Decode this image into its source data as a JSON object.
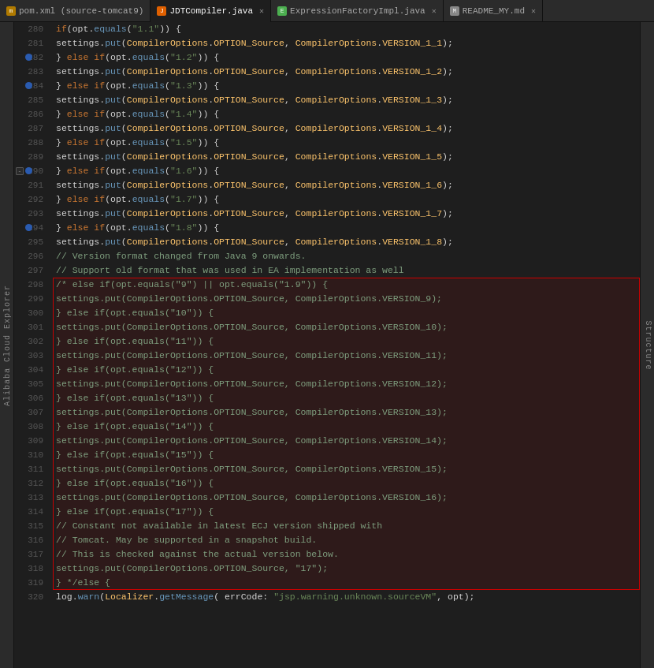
{
  "tabs": [
    {
      "id": "pom",
      "label": "pom.xml (source-tomcat9)",
      "icon": "maven",
      "active": false,
      "closable": false
    },
    {
      "id": "jdt",
      "label": "JDTCompiler.java",
      "icon": "java-j",
      "active": true,
      "closable": true
    },
    {
      "id": "expr",
      "label": "ExpressionFactoryImpl.java",
      "icon": "java-e",
      "active": false,
      "closable": true
    },
    {
      "id": "readme",
      "label": "README_MY.md",
      "icon": "md",
      "active": false,
      "closable": true
    }
  ],
  "sidebar_left": "Alibaba Cloud Explorer",
  "sidebar_right": "Structure",
  "lines": [
    {
      "num": 280,
      "indent": 2,
      "content": "if(opt.equals(\"1.1\")) {",
      "type": "code",
      "has_gutter": false
    },
    {
      "num": 281,
      "indent": 3,
      "content": "settings.put(CompilerOptions.OPTION_Source, CompilerOptions.VERSION_1_1);",
      "type": "code"
    },
    {
      "num": 282,
      "indent": 2,
      "content": "} else if(opt.equals(\"1.2\")) {",
      "type": "code"
    },
    {
      "num": 283,
      "indent": 3,
      "content": "settings.put(CompilerOptions.OPTION_Source, CompilerOptions.VERSION_1_2);",
      "type": "code"
    },
    {
      "num": 284,
      "indent": 2,
      "content": "} else if(opt.equals(\"1.3\")) {",
      "type": "code"
    },
    {
      "num": 285,
      "indent": 3,
      "content": "settings.put(CompilerOptions.OPTION_Source, CompilerOptions.VERSION_1_3);",
      "type": "code"
    },
    {
      "num": 286,
      "indent": 2,
      "content": "} else if(opt.equals(\"1.4\")) {",
      "type": "code"
    },
    {
      "num": 287,
      "indent": 3,
      "content": "settings.put(CompilerOptions.OPTION_Source, CompilerOptions.VERSION_1_4);",
      "type": "code"
    },
    {
      "num": 288,
      "indent": 2,
      "content": "} else if(opt.equals(\"1.5\")) {",
      "type": "code"
    },
    {
      "num": 289,
      "indent": 3,
      "content": "settings.put(CompilerOptions.OPTION_Source, CompilerOptions.VERSION_1_5);",
      "type": "code"
    },
    {
      "num": 290,
      "indent": 2,
      "content": "} else if(opt.equals(\"1.6\")) {",
      "type": "code",
      "has_gutter": true
    },
    {
      "num": 291,
      "indent": 3,
      "content": "settings.put(CompilerOptions.OPTION_Source, CompilerOptions.VERSION_1_6);",
      "type": "code"
    },
    {
      "num": 292,
      "indent": 2,
      "content": "} else if(opt.equals(\"1.7\")) {",
      "type": "code"
    },
    {
      "num": 293,
      "indent": 3,
      "content": "settings.put(CompilerOptions.OPTION_Source, CompilerOptions.VERSION_1_7);",
      "type": "code"
    },
    {
      "num": 294,
      "indent": 2,
      "content": "} else if(opt.equals(\"1.8\")) {",
      "type": "code"
    },
    {
      "num": 295,
      "indent": 3,
      "content": "settings.put(CompilerOptions.OPTION_Source, CompilerOptions.VERSION_1_8);",
      "type": "code"
    },
    {
      "num": 296,
      "indent": 2,
      "content": "// Version format changed from Java 9 onwards.",
      "type": "comment"
    },
    {
      "num": 297,
      "indent": 2,
      "content": "// Support old format that was used in EA implementation as well",
      "type": "comment"
    },
    {
      "num": 298,
      "indent": 2,
      "content": "/* else if(opt.equals(\"9\") || opt.equals(\"1.9\")) {",
      "type": "commented",
      "block_start": true
    },
    {
      "num": 299,
      "indent": 3,
      "content": "settings.put(CompilerOptions.OPTION_Source, CompilerOptions.VERSION_9);",
      "type": "commented"
    },
    {
      "num": 300,
      "indent": 2,
      "content": "} else if(opt.equals(\"10\")) {",
      "type": "commented"
    },
    {
      "num": 301,
      "indent": 3,
      "content": "settings.put(CompilerOptions.OPTION_Source, CompilerOptions.VERSION_10);",
      "type": "commented"
    },
    {
      "num": 302,
      "indent": 2,
      "content": "} else if(opt.equals(\"11\")) {",
      "type": "commented"
    },
    {
      "num": 303,
      "indent": 3,
      "content": "settings.put(CompilerOptions.OPTION_Source, CompilerOptions.VERSION_11);",
      "type": "commented"
    },
    {
      "num": 304,
      "indent": 2,
      "content": "} else if(opt.equals(\"12\")) {",
      "type": "commented"
    },
    {
      "num": 305,
      "indent": 3,
      "content": "settings.put(CompilerOptions.OPTION_Source, CompilerOptions.VERSION_12);",
      "type": "commented"
    },
    {
      "num": 306,
      "indent": 2,
      "content": "} else if(opt.equals(\"13\")) {",
      "type": "commented"
    },
    {
      "num": 307,
      "indent": 3,
      "content": "settings.put(CompilerOptions.OPTION_Source, CompilerOptions.VERSION_13);",
      "type": "commented"
    },
    {
      "num": 308,
      "indent": 2,
      "content": "} else if(opt.equals(\"14\")) {",
      "type": "commented"
    },
    {
      "num": 309,
      "indent": 3,
      "content": "settings.put(CompilerOptions.OPTION_Source, CompilerOptions.VERSION_14);",
      "type": "commented"
    },
    {
      "num": 310,
      "indent": 2,
      "content": "} else if(opt.equals(\"15\")) {",
      "type": "commented"
    },
    {
      "num": 311,
      "indent": 3,
      "content": "settings.put(CompilerOptions.OPTION_Source, CompilerOptions.VERSION_15);",
      "type": "commented"
    },
    {
      "num": 312,
      "indent": 2,
      "content": "} else if(opt.equals(\"16\")) {",
      "type": "commented"
    },
    {
      "num": 313,
      "indent": 3,
      "content": "settings.put(CompilerOptions.OPTION_Source, CompilerOptions.VERSION_16);",
      "type": "commented"
    },
    {
      "num": 314,
      "indent": 2,
      "content": "} else if(opt.equals(\"17\")) {",
      "type": "commented"
    },
    {
      "num": 315,
      "indent": 3,
      "content": "// Constant not available in latest ECJ version shipped with",
      "type": "commented"
    },
    {
      "num": 316,
      "indent": 3,
      "content": "// Tomcat. May be supported in a snapshot build.",
      "type": "commented"
    },
    {
      "num": 317,
      "indent": 3,
      "content": "// This is checked against the actual version below.",
      "type": "commented"
    },
    {
      "num": 318,
      "indent": 3,
      "content": "settings.put(CompilerOptions.OPTION_Source, \"17\");",
      "type": "commented"
    },
    {
      "num": 319,
      "indent": 2,
      "content": "} */else {",
      "type": "commented",
      "block_end": true
    },
    {
      "num": 320,
      "indent": 3,
      "content": "log.warn(Localizer.getMessage( errCode: \"jsp.warning.unknown.sourceVM\", opt);",
      "type": "code",
      "partial": true
    }
  ]
}
